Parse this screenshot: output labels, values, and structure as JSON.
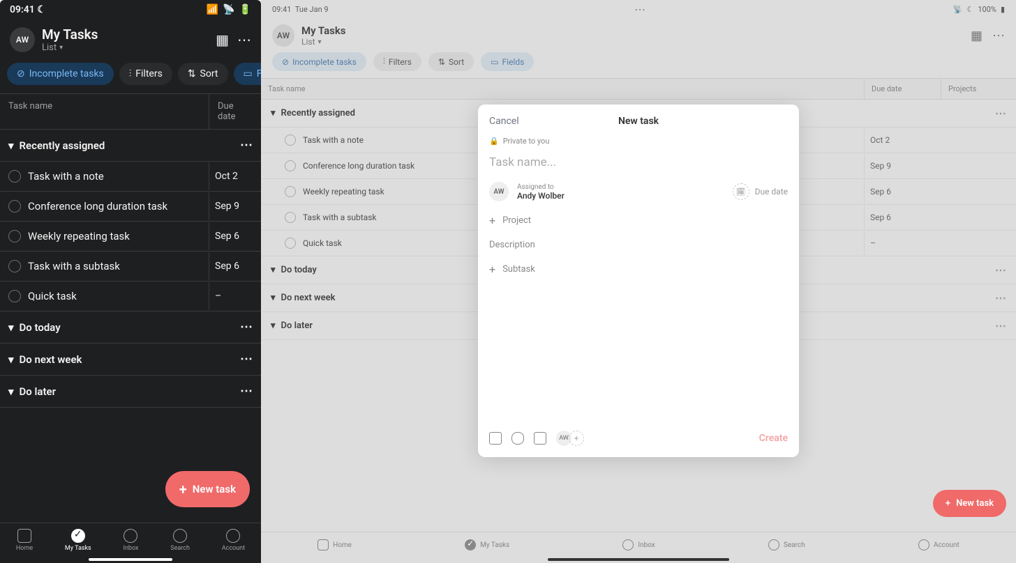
{
  "phone": {
    "status": {
      "time": "09:41",
      "icons": [
        "📶",
        "📡",
        "🔋"
      ],
      "moon": "☾"
    },
    "avatar": "AW",
    "title": "My Tasks",
    "sub": "List",
    "filters": [
      "Incomplete tasks",
      "Filters",
      "Sort",
      "Fields"
    ],
    "columns": [
      "Task name",
      "Due date"
    ],
    "sections": [
      "Recently assigned",
      "Do today",
      "Do next week",
      "Do later"
    ],
    "tasks": [
      {
        "name": "Task with a note",
        "date": "Oct 2"
      },
      {
        "name": "Conference long duration task",
        "date": "Sep 9"
      },
      {
        "name": "Weekly repeating task",
        "date": "Sep 6"
      },
      {
        "name": "Task with a subtask",
        "date": "Sep 6"
      },
      {
        "name": "Quick task",
        "date": "–"
      }
    ],
    "fab": "New task",
    "tabs": [
      "Home",
      "My Tasks",
      "Inbox",
      "Search",
      "Account"
    ]
  },
  "tablet": {
    "status": {
      "time": "09:41",
      "date": "Tue Jan 9",
      "battery": "100%"
    },
    "avatar": "AW",
    "title": "My Tasks",
    "sub": "List",
    "filters": [
      "Incomplete tasks",
      "Filters",
      "Sort",
      "Fields"
    ],
    "columns": [
      "Task name",
      "Due date",
      "Projects"
    ],
    "sections": [
      "Recently assigned",
      "Do today",
      "Do next week",
      "Do later"
    ],
    "tasks": [
      {
        "name": "Task with a note",
        "date": "Oct 2"
      },
      {
        "name": "Conference long duration task",
        "date": "Sep 9"
      },
      {
        "name": "Weekly repeating task",
        "date": "Sep 6"
      },
      {
        "name": "Task with a subtask",
        "date": "Sep 6"
      },
      {
        "name": "Quick task",
        "date": "–"
      }
    ],
    "fab": "New task",
    "tabs": [
      "Home",
      "My Tasks",
      "Inbox",
      "Search",
      "Account"
    ]
  },
  "modal": {
    "cancel": "Cancel",
    "title": "New task",
    "private": "Private to you",
    "placeholder": "Task name...",
    "assigned_label": "Assigned to",
    "assignee": "Andy Wolber",
    "assignee_avatar": "AW",
    "due": "Due date",
    "project": "Project",
    "description": "Description",
    "subtask": "Subtask",
    "create": "Create"
  }
}
